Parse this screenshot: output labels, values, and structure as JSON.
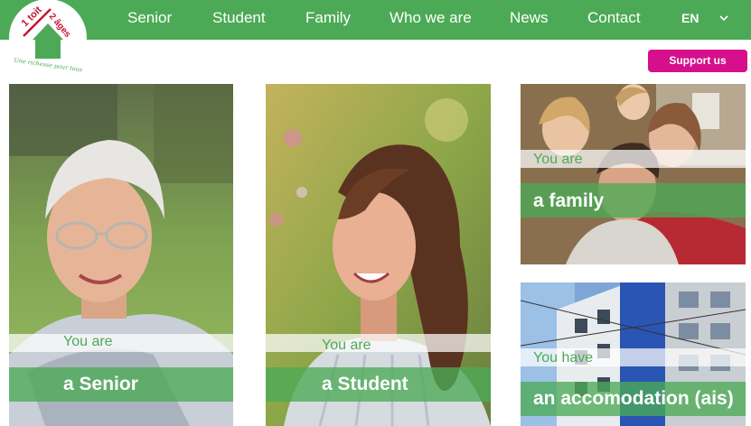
{
  "logo": {
    "primary_text": "1 toit",
    "secondary_text": "2 âges",
    "tagline": "Une richesse pour tous"
  },
  "nav": {
    "items": [
      "Senior",
      "Student",
      "Family",
      "Who we are",
      "News",
      "Contact"
    ],
    "language": "EN"
  },
  "support_button": "Support us",
  "cards": [
    {
      "you": "You are",
      "label": "a Senior"
    },
    {
      "you": "You are",
      "label": "a  Student"
    },
    {
      "you": "You are",
      "label": "a family"
    },
    {
      "you": "You have",
      "label": "an accomodation (ais)"
    }
  ],
  "colors": {
    "brand_green": "#4caa56",
    "accent_magenta": "#d6108d",
    "logo_red": "#c8102e"
  }
}
